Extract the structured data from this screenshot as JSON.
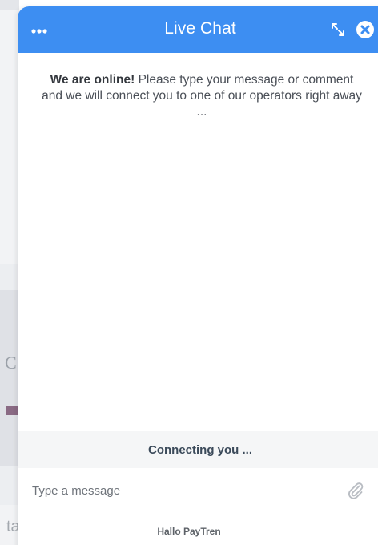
{
  "chat": {
    "title": "Live Chat",
    "welcome_strong": "We are online!",
    "welcome_text": " Please type your message or comment and we will connect you to one of our operators right away ...",
    "status": "Connecting you ...",
    "input_placeholder": "Type a message",
    "brand": "Hallo PayTren"
  },
  "background": {
    "fragment_cu": "Cu",
    "fragment_ta": "ta"
  },
  "icons": {
    "menu": "ellipsis-icon",
    "expand": "expand-icon",
    "close": "close-circle-icon",
    "attach": "paperclip-icon"
  },
  "colors": {
    "header": "#3d8ef2",
    "status_bg": "#f5f6f7",
    "status_text": "#3b4a5a"
  }
}
